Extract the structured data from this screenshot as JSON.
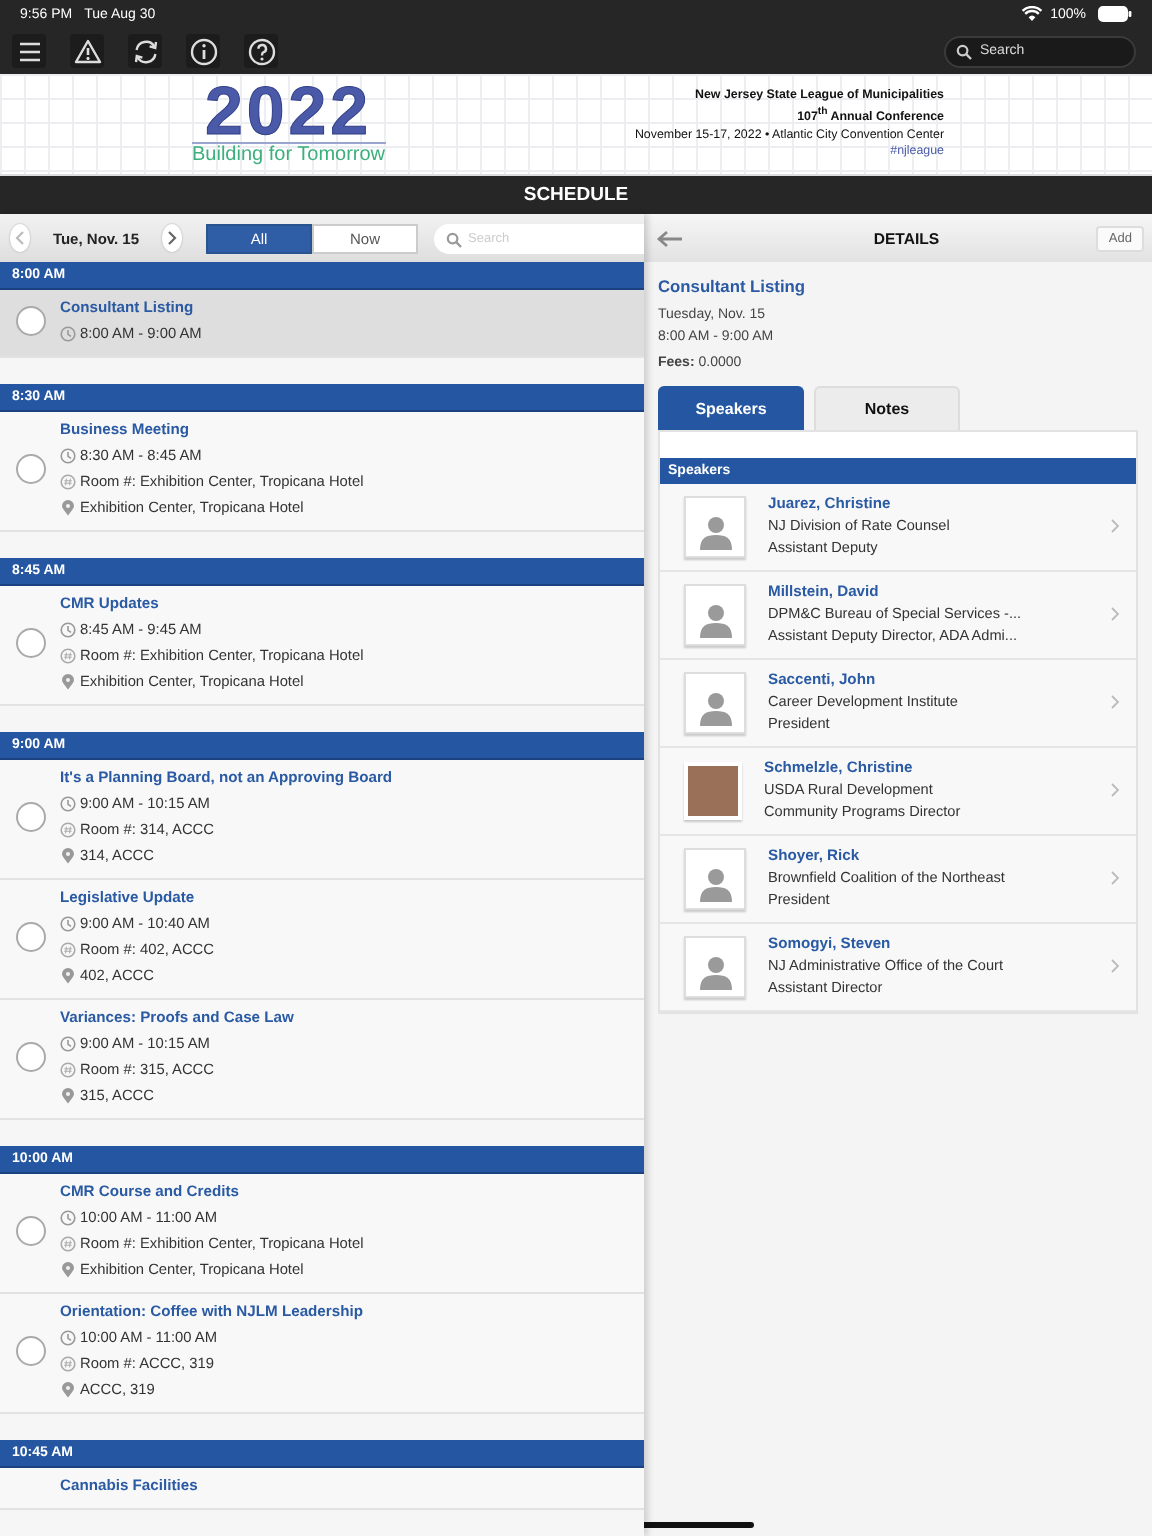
{
  "status_bar": {
    "time": "9:56 PM",
    "date": "Tue Aug 30",
    "battery": "100%"
  },
  "toolbar": {
    "search": {
      "placeholder": "Search"
    }
  },
  "banner": {
    "logo_year": "2022",
    "logo_tagline": "Building for Tomorrow",
    "organization": "New Jersey State League of Municipalities",
    "conference": "107$^{th}$ Annual Conference",
    "dates_venue": "November 15-17, 2022 • Atlantic City Convention Center",
    "hashtag": "#njleague"
  },
  "title_bar": {
    "title": "SCHEDULE"
  },
  "schedule": {
    "date": "Tue, Nov. 15",
    "filters": [
      {
        "label": "All",
        "selected": true
      },
      {
        "label": "Now",
        "selected": false
      }
    ],
    "search": {
      "placeholder": "Search"
    },
    "groups": [
      {
        "time": "8:00 AM",
        "events": [
          {
            "title": "Consultant Listing",
            "time": "8:00 AM - 9:00 AM",
            "selected": true,
            "checked": false
          }
        ]
      },
      {
        "time": "8:30 AM",
        "events": [
          {
            "title": "Business Meeting",
            "time": "8:30 AM - 8:45 AM",
            "room": "Room #: Exhibition Center, Tropicana Hotel",
            "location": "Exhibition Center, Tropicana Hotel",
            "selected": false,
            "checked": false
          }
        ]
      },
      {
        "time": "8:45 AM",
        "events": [
          {
            "title": "CMR Updates",
            "time": "8:45 AM - 9:45 AM",
            "room": "Room #: Exhibition Center, Tropicana Hotel",
            "location": "Exhibition Center, Tropicana Hotel",
            "selected": false,
            "checked": false
          }
        ]
      },
      {
        "time": "9:00 AM",
        "events": [
          {
            "title": "It's a Planning Board, not an Approving Board",
            "time": "9:00 AM - 10:15 AM",
            "room": "Room #: 314, ACCC",
            "location": "314, ACCC",
            "selected": false,
            "checked": false
          },
          {
            "title": "Legislative Update",
            "time": "9:00 AM - 10:40 AM",
            "room": "Room #: 402, ACCC",
            "location": "402, ACCC",
            "selected": false,
            "checked": false
          },
          {
            "title": "Variances: Proofs and Case Law",
            "time": "9:00 AM - 10:15 AM",
            "room": "Room #: 315, ACCC",
            "location": "315, ACCC",
            "selected": false,
            "checked": false
          }
        ]
      },
      {
        "time": "10:00 AM",
        "events": [
          {
            "title": "CMR Course and Credits",
            "time": "10:00 AM - 11:00 AM",
            "room": "Room #: Exhibition Center, Tropicana Hotel",
            "location": "Exhibition Center, Tropicana Hotel",
            "selected": false,
            "checked": false
          },
          {
            "title": "Orientation:  Coffee with NJLM Leadership",
            "time": "10:00 AM - 11:00 AM",
            "room": "Room #: ACCC, 319",
            "location": "ACCC, 319",
            "selected": false,
            "checked": false
          }
        ]
      },
      {
        "time": "10:45 AM",
        "events": [
          {
            "title": "Cannabis Facilities",
            "selected": false
          }
        ]
      }
    ]
  },
  "details": {
    "header": "DETAILS",
    "add_button": "Add",
    "title": "Consultant Listing",
    "date": "Tuesday, Nov. 15",
    "time": "8:00 AM - 9:00 AM",
    "fees": "**Fees:** 0.0000",
    "tabs": [
      {
        "label": "Speakers",
        "selected": true
      },
      {
        "label": "Notes",
        "selected": false
      }
    ],
    "section_header": "Speakers",
    "speakers": [
      {
        "kind": "placeholder",
        "name": "Juarez, Christine",
        "organization": "NJ Division of Rate Counsel",
        "role": "Assistant Deputy"
      },
      {
        "kind": "placeholder",
        "name": "Millstein, David",
        "organization": "DPM&C Bureau of Special Services -...",
        "role": "Assistant Deputy Director, ADA Admi..."
      },
      {
        "kind": "placeholder",
        "name": "Saccenti, John",
        "organization": "Career Development Institute",
        "role": "President"
      },
      {
        "kind": "photo",
        "name": "Schmelzle, Christine",
        "organization": "USDA Rural Development",
        "role": "Community Programs Director"
      },
      {
        "kind": "placeholder",
        "name": "Shoyer, Rick",
        "organization": "Brownfield Coalition of the Northeast",
        "role": "President"
      },
      {
        "kind": "placeholder",
        "name": "Somogyi, Steven",
        "organization": "NJ Administrative Office of the Court",
        "role": "Assistant Director"
      }
    ]
  }
}
